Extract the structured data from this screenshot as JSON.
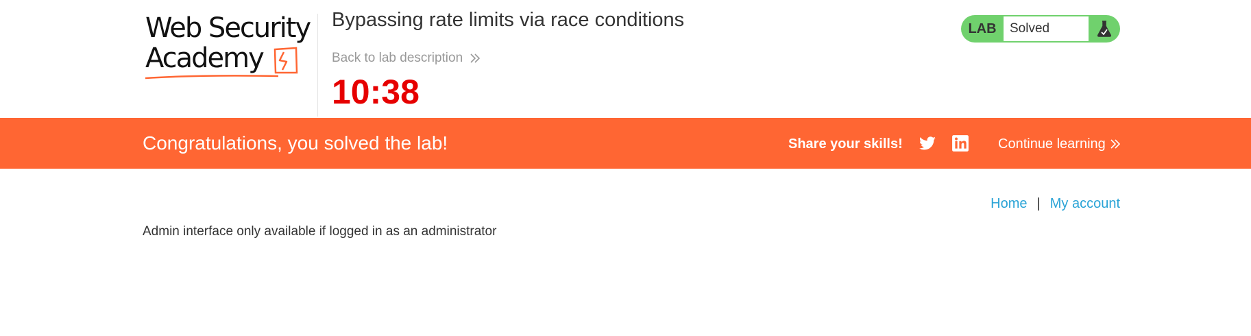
{
  "header": {
    "logo": {
      "line1": "Web Security",
      "line2": "Academy"
    },
    "lab_title": "Bypassing rate limits via race conditions",
    "back_link": "Back to lab description",
    "timer": "10:38",
    "lab_status": {
      "label": "LAB",
      "state": "Solved",
      "color": "#70d16d"
    }
  },
  "banner": {
    "message": "Congratulations, you solved the lab!",
    "share_label": "Share your skills!",
    "share_icons": [
      "twitter-icon",
      "linkedin-icon"
    ],
    "continue_label": "Continue learning",
    "color": "#ff6633"
  },
  "nav": {
    "home": "Home",
    "separator": "|",
    "account": "My account"
  },
  "content": {
    "message": "Admin interface only available if logged in as an administrator"
  },
  "colors": {
    "timer": "#e60000",
    "link": "#29a3d6",
    "muted": "#999999"
  }
}
